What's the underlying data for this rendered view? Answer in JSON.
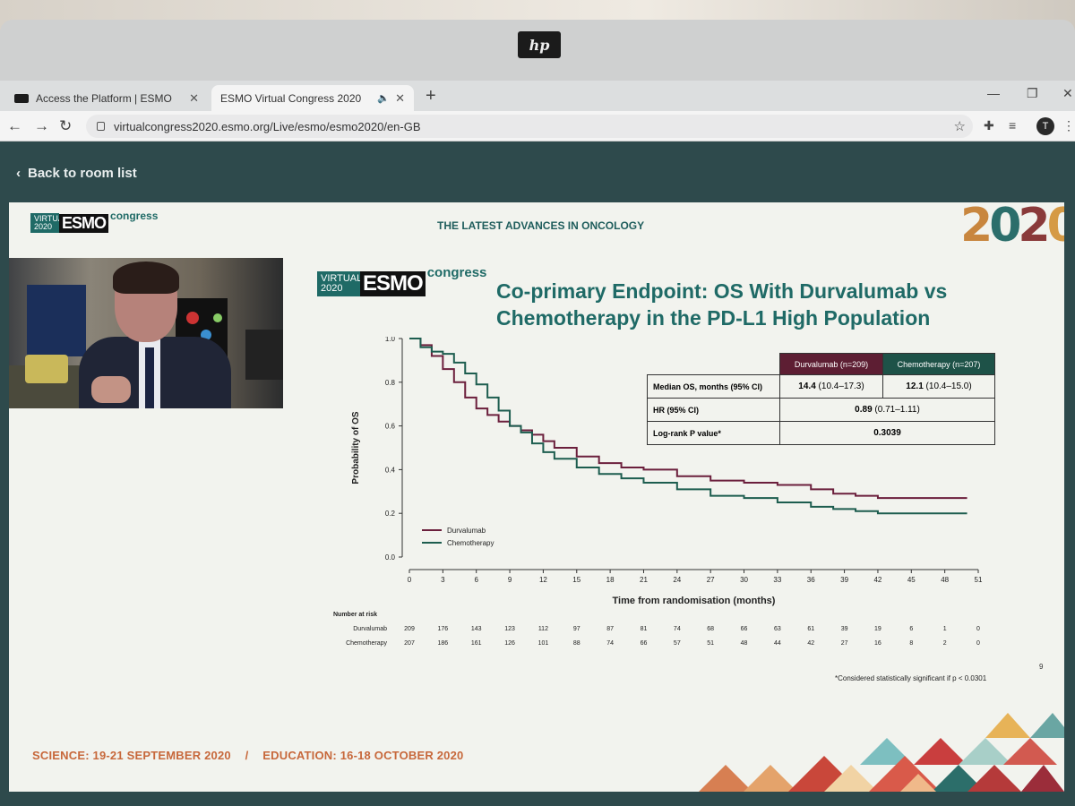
{
  "browser": {
    "tabs": [
      {
        "label": "Access the Platform | ESMO"
      },
      {
        "label": "ESMO Virtual Congress 2020"
      }
    ],
    "url": "virtualcongress2020.esmo.org/Live/esmo/esmo2020/en-GB",
    "profile_initial": "T",
    "monitor_logo": "hp"
  },
  "page": {
    "back_label": "Back to room list"
  },
  "slide": {
    "brand_virtual": "VIRTUAL 2020",
    "brand_esmo": "ESMO",
    "brand_congress": "congress",
    "headline": "THE LATEST ADVANCES IN ONCOLOGY",
    "year": [
      "2",
      "0",
      "2",
      "0"
    ],
    "title_line1": "Co-primary Endpoint: OS With Durvalumab vs",
    "title_line2": "Chemotherapy in the PD-L1 High Population",
    "table": {
      "col_durv": "Durvalumab (n=209)",
      "col_chemo": "Chemotherapy (n=207)",
      "rows": [
        {
          "label": "Median OS, months (95% CI)",
          "durv_bold": "14.4",
          "durv_ci": "(10.4–17.3)",
          "chemo_bold": "12.1",
          "chemo_ci": "(10.4–15.0)"
        },
        {
          "label": "HR (95% CI)",
          "combined_bold": "0.89",
          "combined_ci": "(0.71–1.11)"
        },
        {
          "label": "Log-rank P value*",
          "combined_bold": "0.3039"
        }
      ]
    },
    "footnote": "*Considered statistically significant if p < 0.0301",
    "page_number": "9",
    "footer_science": "SCIENCE: 19-21 SEPTEMBER 2020",
    "footer_sep": "/",
    "footer_education": "EDUCATION: 16-18 OCTOBER 2020"
  },
  "chart_data": {
    "type": "line",
    "xlabel": "Time from randomisation (months)",
    "ylabel": "Probability of OS",
    "xlim": [
      0,
      51
    ],
    "ylim": [
      0.0,
      1.0
    ],
    "x_ticks": [
      0,
      3,
      6,
      9,
      12,
      15,
      18,
      21,
      24,
      27,
      30,
      33,
      36,
      39,
      42,
      45,
      48,
      51
    ],
    "y_ticks": [
      "0.0",
      "0.2",
      "0.4",
      "0.6",
      "0.8",
      "1.0"
    ],
    "legend_placement": "bottom-left",
    "series": [
      {
        "name": "Durvalumab",
        "color": "#6b1f3c",
        "x": [
          0,
          1,
          2,
          3,
          4,
          5,
          6,
          7,
          8,
          9,
          10,
          11,
          12,
          13,
          15,
          17,
          19,
          21,
          24,
          27,
          30,
          33,
          36,
          38,
          40,
          42,
          45,
          48,
          50
        ],
        "y": [
          1.0,
          0.97,
          0.92,
          0.86,
          0.8,
          0.73,
          0.68,
          0.65,
          0.62,
          0.6,
          0.58,
          0.56,
          0.53,
          0.5,
          0.46,
          0.43,
          0.41,
          0.4,
          0.37,
          0.35,
          0.34,
          0.33,
          0.31,
          0.29,
          0.28,
          0.27,
          0.27,
          0.27,
          0.27
        ]
      },
      {
        "name": "Chemotherapy",
        "color": "#1d5d4f",
        "x": [
          0,
          1,
          2,
          3,
          4,
          5,
          6,
          7,
          8,
          9,
          10,
          11,
          12,
          13,
          15,
          17,
          19,
          21,
          24,
          27,
          30,
          33,
          36,
          38,
          40,
          42,
          45,
          48,
          50
        ],
        "y": [
          1.0,
          0.96,
          0.94,
          0.93,
          0.89,
          0.84,
          0.79,
          0.73,
          0.67,
          0.6,
          0.57,
          0.52,
          0.48,
          0.45,
          0.41,
          0.38,
          0.36,
          0.34,
          0.31,
          0.28,
          0.27,
          0.25,
          0.23,
          0.22,
          0.21,
          0.2,
          0.2,
          0.2,
          0.2
        ]
      }
    ],
    "risk_table": {
      "title": "Number at risk",
      "times": [
        0,
        3,
        6,
        9,
        12,
        15,
        18,
        21,
        24,
        27,
        30,
        33,
        36,
        39,
        42,
        45,
        48,
        51
      ],
      "rows": [
        {
          "name": "Durvalumab",
          "counts": [
            209,
            176,
            143,
            123,
            112,
            97,
            87,
            81,
            74,
            68,
            66,
            63,
            61,
            39,
            19,
            6,
            1,
            0
          ]
        },
        {
          "name": "Chemotherapy",
          "counts": [
            207,
            186,
            161,
            126,
            101,
            88,
            74,
            66,
            57,
            51,
            48,
            44,
            42,
            27,
            16,
            8,
            2,
            0
          ]
        }
      ]
    }
  }
}
